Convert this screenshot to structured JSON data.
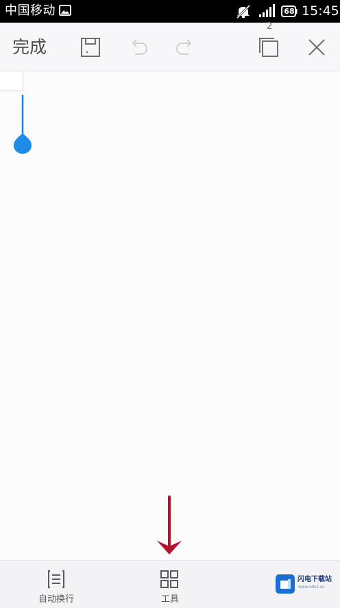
{
  "status_bar": {
    "carrier": "中国移动",
    "battery": "68",
    "time": "15:45",
    "icons": [
      "image-icon",
      "mute-icon",
      "signal-icon",
      "battery-icon"
    ]
  },
  "toolbar": {
    "done_label": "完成",
    "pages_count": "2",
    "icons": [
      "save-icon",
      "undo-icon",
      "redo-icon",
      "pages-icon",
      "close-icon"
    ]
  },
  "bottom_bar": {
    "auto_wrap_label": "自动换行",
    "tools_label": "工具"
  },
  "watermark": {
    "title": "闪电下载站",
    "url": "www.sdxz.cc"
  },
  "colors": {
    "accent": "#1e8be8",
    "arrow": "#c0142b",
    "toolbar_bg": "#f7f6f8",
    "bottombar_bg": "#f3f2f5",
    "status_bar_bg": "#000000"
  }
}
